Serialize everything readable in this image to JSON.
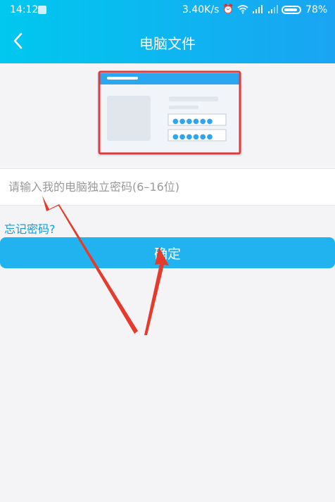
{
  "status_bar": {
    "time": "14:12",
    "net_speed": "3.40K/s",
    "battery_percent": "78%",
    "icons": [
      "notification-icon",
      "alarm-icon",
      "wifi-icon",
      "signal-icon",
      "signal-icon",
      "battery-icon"
    ]
  },
  "header": {
    "title": "电脑文件",
    "back_icon": "chevron-left-icon",
    "bg_start": "#00c8ef",
    "bg_end": "#1aa4f2"
  },
  "illustration": {
    "password_masks": [
      "●●●●●●",
      "●●●●●●"
    ],
    "highlight_color": "#e03a3a"
  },
  "password_input": {
    "placeholder": "请输入我的电脑独立密码(6–16位)",
    "value": ""
  },
  "forgot_link": "忘记密码?",
  "confirm_button": "确定",
  "colors": {
    "accent": "#21b3ef",
    "link": "#0e9ee6",
    "annotation_arrow": "#e53b2c",
    "background": "#f4f4f6"
  }
}
